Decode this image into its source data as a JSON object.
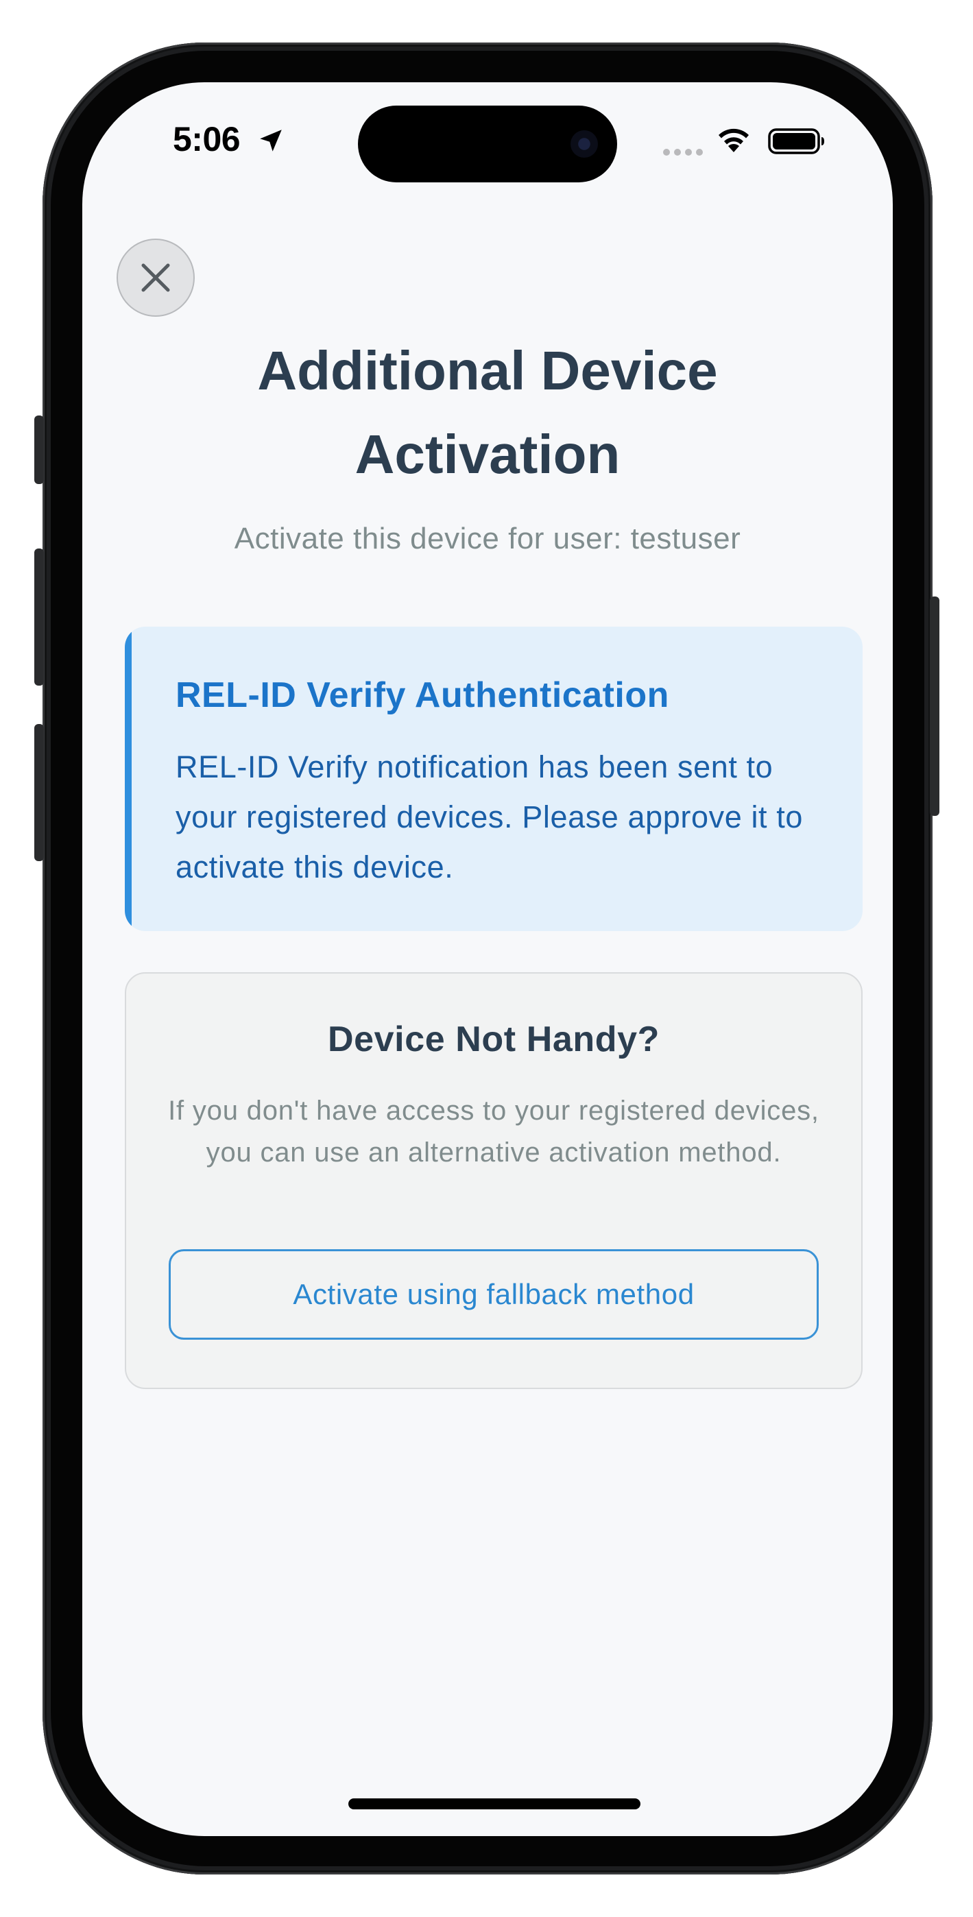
{
  "status_bar": {
    "time": "5:06",
    "location_icon": "location-arrow-icon",
    "signal_icon": "cellular-signal-icon",
    "wifi_icon": "wifi-icon",
    "battery_icon": "battery-full-icon"
  },
  "close_button": {
    "icon": "close-icon"
  },
  "header": {
    "title_line1": "Additional Device",
    "title_line2": "Activation",
    "subtitle": "Activate this device for user: testuser"
  },
  "info_card": {
    "title": "REL-ID Verify Authentication",
    "body": "REL-ID Verify notification has been sent to your registered devices. Please approve it to activate this device.",
    "accent_color": "#2f8fde",
    "background_color": "#e3f0fb"
  },
  "fallback_card": {
    "title": "Device Not Handy?",
    "description": "If you don't have access to your registered devices, you can use an alternative activation method.",
    "button_label": "Activate using fallback method",
    "button_color": "#2a87d0"
  },
  "colors": {
    "screen_background": "#f7f8fa",
    "title_text": "#2c3e50",
    "muted_text": "#7f8c8d"
  }
}
